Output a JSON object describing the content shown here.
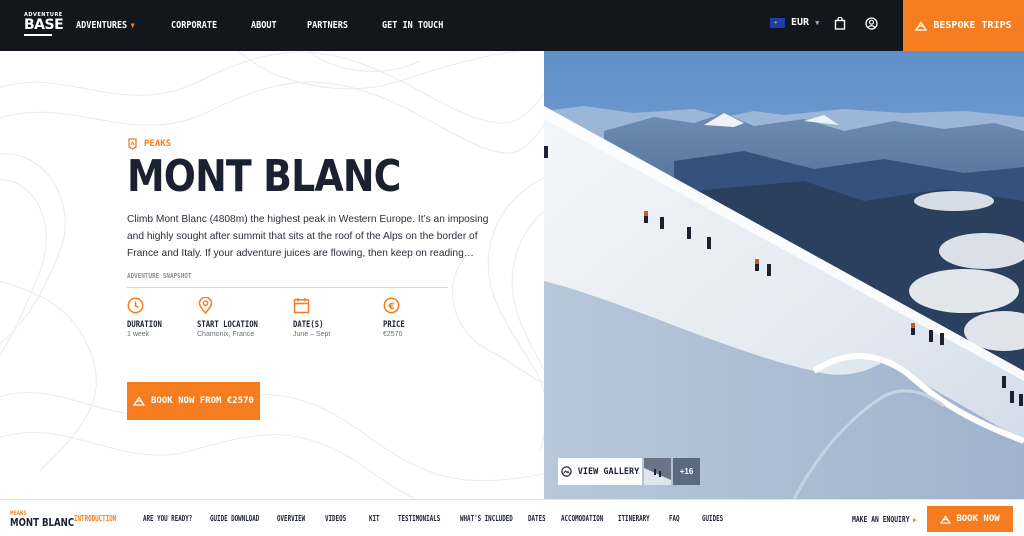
{
  "brand": {
    "logo_small": "ADVENTURE",
    "logo_big": "BASE"
  },
  "nav": {
    "items": [
      {
        "label": "ADVENTURES",
        "has_dropdown": true
      },
      {
        "label": "CORPORATE"
      },
      {
        "label": "ABOUT"
      },
      {
        "label": "PARTNERS"
      },
      {
        "label": "GET IN TOUCH"
      }
    ],
    "currency": "EUR",
    "cart_icon": "shopping-bag-icon",
    "account_icon": "user-circle-icon",
    "cta": "BESPOKE TRIPS"
  },
  "hero": {
    "category": "PEAKS",
    "title": "MONT BLANC",
    "description": "Climb Mont Blanc (4808m) the highest peak in Western Europe. It’s an imposing and highly sought after summit that sits at the roof of the Alps on the border of France and Italy. If your adventure juices are flowing, then keep on reading…",
    "snapshot_label": "ADVENTURE SNAPSHOT",
    "stats": [
      {
        "label": "DURATION",
        "value": "1 week",
        "icon": "clock-icon"
      },
      {
        "label": "START LOCATION",
        "value": "Chamonix, France",
        "icon": "map-pin-icon"
      },
      {
        "label": "DATE(S)",
        "value": "June – Sept",
        "icon": "calendar-icon"
      },
      {
        "label": "PRICE",
        "value": "€2570",
        "icon": "euro-icon"
      }
    ],
    "cta": "BOOK NOW FROM €2570"
  },
  "gallery": {
    "button": "VIEW GALLERY",
    "more_count": "+16"
  },
  "subnav": {
    "category": "PEAKS",
    "name": "MONT BLANC",
    "links": [
      {
        "label": "INTRODUCTION",
        "active": true
      },
      {
        "label": "ARE YOU READY?"
      },
      {
        "label": "GUIDE DOWNLOAD"
      },
      {
        "label": "OVERVIEW"
      },
      {
        "label": "VIDEOS"
      },
      {
        "label": "KIT"
      },
      {
        "label": "TESTIMONIALS"
      },
      {
        "label": "WHAT'S INCLUDED"
      },
      {
        "label": "DATES"
      },
      {
        "label": "ACCOMODATION"
      },
      {
        "label": "ITINERARY"
      },
      {
        "label": "FAQ"
      },
      {
        "label": "GUIDES"
      }
    ],
    "enquiry": "MAKE AN ENQUIRY",
    "cta": "BOOK NOW"
  },
  "colors": {
    "accent": "#f57c1f",
    "dark": "#13161d",
    "text": "#1b2130"
  }
}
